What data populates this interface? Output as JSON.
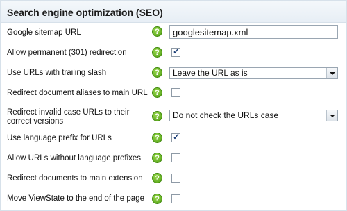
{
  "header": {
    "title": "Search engine optimization (SEO)"
  },
  "rows": [
    {
      "label": "Google sitemap URL",
      "help": "?",
      "control": "text",
      "value": "googlesitemap.xml"
    },
    {
      "label": "Allow permanent (301) redirection",
      "help": "?",
      "control": "checkbox",
      "checked": true
    },
    {
      "label": "Use URLs with trailing slash",
      "help": "?",
      "control": "select",
      "value": "Leave the URL as is"
    },
    {
      "label": "Redirect document aliases to main URL",
      "help": "?",
      "control": "checkbox",
      "checked": false
    },
    {
      "label": "Redirect invalid case URLs to their correct versions",
      "help": "?",
      "control": "select",
      "value": "Do not check the URLs case"
    },
    {
      "label": "Use language prefix for URLs",
      "help": "?",
      "control": "checkbox",
      "checked": true
    },
    {
      "label": "Allow URLs without language prefixes",
      "help": "?",
      "control": "checkbox",
      "checked": false
    },
    {
      "label": "Redirect documents to main extension",
      "help": "?",
      "control": "checkbox",
      "checked": false
    },
    {
      "label": "Move ViewState to the end of the page",
      "help": "?",
      "control": "checkbox",
      "checked": false
    }
  ],
  "colors": {
    "help_icon": "#5aa619",
    "header_bg": "#e9f0f6"
  }
}
